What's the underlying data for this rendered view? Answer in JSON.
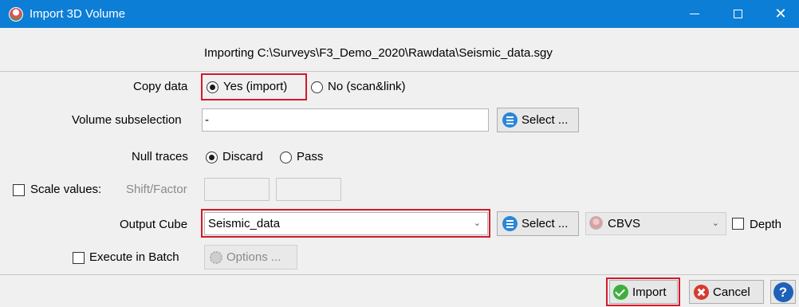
{
  "window": {
    "title": "Import 3D Volume",
    "controls": {
      "minimize": "—",
      "maximize": "□",
      "close": "✕"
    }
  },
  "header": {
    "importing_text": "Importing C:\\Surveys\\F3_Demo_2020\\Rawdata\\Seismic_data.sgy"
  },
  "copy_data": {
    "label": "Copy data",
    "options": [
      "Yes (import)",
      "No (scan&link)"
    ],
    "selected": "Yes (import)"
  },
  "volume_subselection": {
    "label": "Volume subselection",
    "value": "-",
    "select_label": "Select ..."
  },
  "null_traces": {
    "label": "Null traces",
    "options": [
      "Discard",
      "Pass"
    ],
    "selected": "Discard"
  },
  "scale_values": {
    "label": "Scale values:",
    "checked": false,
    "shift_factor_label": "Shift/Factor",
    "shift": "",
    "factor": ""
  },
  "output_cube": {
    "label": "Output Cube",
    "value": "Seismic_data",
    "select_label": "Select ...",
    "format": "CBVS",
    "depth_label": "Depth",
    "depth_checked": false
  },
  "batch": {
    "execute_label": "Execute in Batch",
    "checked": false,
    "options_label": "Options ..."
  },
  "footer": {
    "import_label": "Import",
    "cancel_label": "Cancel",
    "help_label": "?"
  },
  "colors": {
    "titlebar": "#0c7ed6",
    "highlight": "#d11a2a",
    "background": "#f0f0f0"
  }
}
